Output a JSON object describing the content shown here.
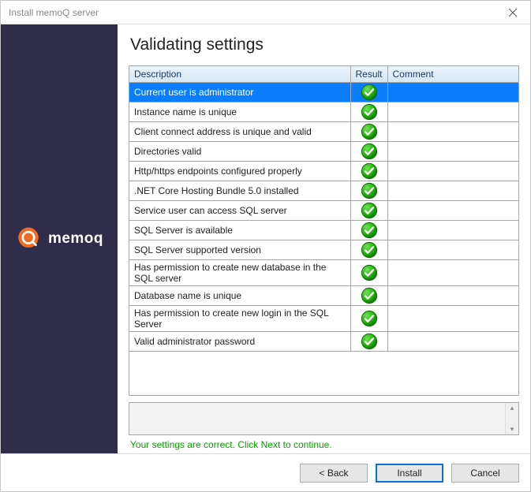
{
  "window": {
    "title": "Install memoQ server"
  },
  "brand": {
    "name": "memoq",
    "logo_color": "#f16a22"
  },
  "page": {
    "title": "Validating settings"
  },
  "table": {
    "columns": {
      "description": "Description",
      "result": "Result",
      "comment": "Comment"
    },
    "rows": [
      {
        "description": "Current user is administrator",
        "result": "ok",
        "comment": "",
        "selected": true
      },
      {
        "description": "Instance name is unique",
        "result": "ok",
        "comment": ""
      },
      {
        "description": "Client connect address is unique and valid",
        "result": "ok",
        "comment": ""
      },
      {
        "description": "Directories valid",
        "result": "ok",
        "comment": ""
      },
      {
        "description": "Http/https endpoints configured properly",
        "result": "ok",
        "comment": ""
      },
      {
        "description": ".NET Core Hosting Bundle 5.0 installed",
        "result": "ok",
        "comment": ""
      },
      {
        "description": "Service user can access SQL server",
        "result": "ok",
        "comment": ""
      },
      {
        "description": "SQL Server is available",
        "result": "ok",
        "comment": ""
      },
      {
        "description": "SQL Server supported version",
        "result": "ok",
        "comment": ""
      },
      {
        "description": "Has permission to create new database in the SQL server",
        "result": "ok",
        "comment": ""
      },
      {
        "description": "Database name is unique",
        "result": "ok",
        "comment": ""
      },
      {
        "description": "Has permission to create new login in the SQL Server",
        "result": "ok",
        "comment": ""
      },
      {
        "description": "Valid administrator password",
        "result": "ok",
        "comment": ""
      }
    ]
  },
  "status": {
    "message": "Your settings are correct. Click Next to continue.",
    "color": "#089c00"
  },
  "footer": {
    "back": "< Back",
    "install": "Install",
    "cancel": "Cancel"
  }
}
